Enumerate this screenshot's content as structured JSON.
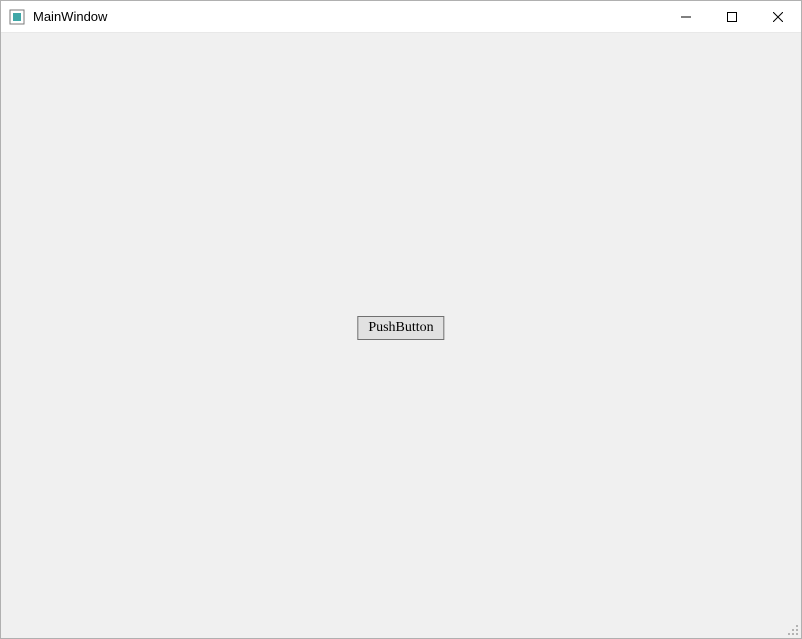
{
  "titlebar": {
    "title": "MainWindow"
  },
  "main": {
    "push_button_label": "PushButton"
  }
}
